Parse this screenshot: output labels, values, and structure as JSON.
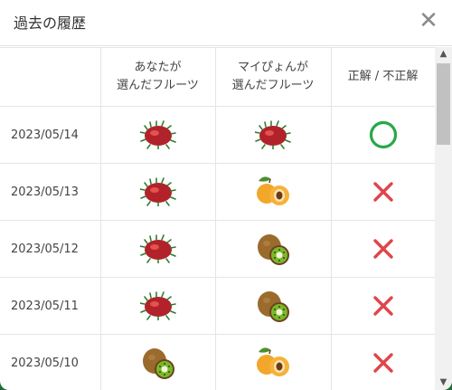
{
  "modal": {
    "title": "過去の履歴",
    "close_icon": "close-icon"
  },
  "table": {
    "headers": {
      "date": "",
      "yours_line1": "あなたが",
      "yours_line2": "選んだフルーツ",
      "mypyon_line1": "マイぴょんが",
      "mypyon_line2": "選んだフルーツ",
      "result": "正解 / 不正解"
    },
    "rows": [
      {
        "date": "2023/05/14",
        "yours": "rambutan-icon",
        "mypyon": "rambutan-icon",
        "result": "correct-circle-icon"
      },
      {
        "date": "2023/05/13",
        "yours": "rambutan-icon",
        "mypyon": "loquat-icon",
        "result": "incorrect-cross-icon"
      },
      {
        "date": "2023/05/12",
        "yours": "rambutan-icon",
        "mypyon": "kiwi-icon",
        "result": "incorrect-cross-icon"
      },
      {
        "date": "2023/05/11",
        "yours": "rambutan-icon",
        "mypyon": "kiwi-icon",
        "result": "incorrect-cross-icon"
      },
      {
        "date": "2023/05/10",
        "yours": "kiwi-icon",
        "mypyon": "loquat-icon",
        "result": "incorrect-cross-icon"
      }
    ]
  },
  "colors": {
    "correct": "#27a84a",
    "incorrect": "#e0454a",
    "header_border": "#e3e3e3"
  }
}
